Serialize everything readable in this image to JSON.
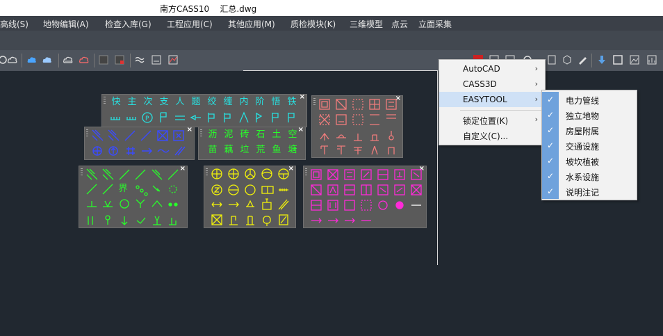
{
  "window": {
    "title": "南方CASS10    汇总.dwg"
  },
  "menubar": [
    "高线(S)",
    "地物编辑(A)",
    "检查入库(G)",
    "工程应用(C)",
    "其他应用(M)",
    "质检模块(K)",
    "三维模型",
    "点云",
    "立面采集"
  ],
  "colors": {
    "canvas": "#212830",
    "panel": "#5a5a5a",
    "yellow": "#f2f20a",
    "cyan": "#28e0e0",
    "blue": "#3a4bff",
    "pink": "#f07c7c",
    "magenta": "#ff2ad8",
    "green": "#28ff2a"
  },
  "panels": {
    "p1": {
      "row1": [
        "快",
        "主",
        "次",
        "支",
        "人",
        "题",
        "绞",
        "缠",
        "内",
        "阶",
        "悟",
        "铁"
      ]
    },
    "p3": {
      "row1": [
        "沥",
        "泥",
        "砖",
        "石",
        "土",
        "空"
      ],
      "row2": [
        "苗",
        "藕",
        "垃",
        "荒",
        "鱼",
        "塘"
      ]
    },
    "p6": {
      "row1_label": "界"
    }
  },
  "context_menu": {
    "items": [
      {
        "label": "AutoCAD",
        "submenu": true
      },
      {
        "label": "CASS3D",
        "submenu": true
      },
      {
        "label": "EASYTOOL",
        "submenu": true,
        "highlighted": true
      },
      {
        "label": "锁定位置(K)",
        "submenu": true
      },
      {
        "label": "自定义(C)...",
        "submenu": false
      }
    ]
  },
  "submenu": {
    "items": [
      {
        "label": "电力管线",
        "checked": true
      },
      {
        "label": "独立地物",
        "checked": true
      },
      {
        "label": "房屋附属",
        "checked": true
      },
      {
        "label": "交通设施",
        "checked": true
      },
      {
        "label": "坡坎植被",
        "checked": true
      },
      {
        "label": "水系设施",
        "checked": true
      },
      {
        "label": "说明注记",
        "checked": true
      }
    ]
  }
}
